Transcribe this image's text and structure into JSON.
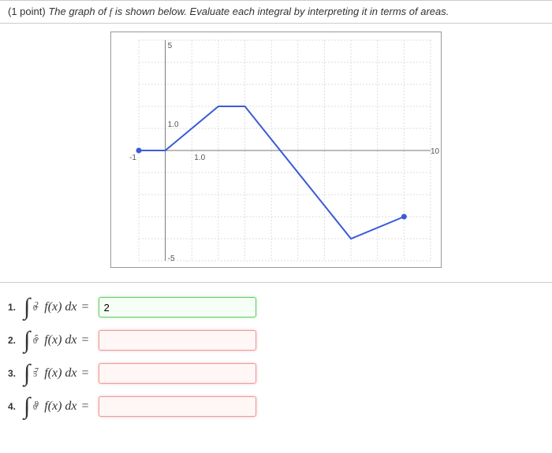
{
  "header": {
    "points": "(1 point)",
    "prompt_before": "The graph of ",
    "prompt_var": "f",
    "prompt_after": " is shown below. Evaluate each integral by interpreting it in terms of areas."
  },
  "graph": {
    "x_range": [
      -1,
      10
    ],
    "y_range": [
      -5,
      5
    ],
    "x_ticks": [
      -1,
      10
    ],
    "y_ticks": [
      -5,
      5
    ],
    "labels": {
      "y_top": "5",
      "y_mid": "1.0",
      "y_bot": "-5",
      "x_left": "-1",
      "x_mid": "1.0",
      "x_right": "10"
    },
    "points_data": [
      {
        "x": -1,
        "y": 0
      },
      {
        "x": 0,
        "y": 0
      },
      {
        "x": 2,
        "y": 2
      },
      {
        "x": 3,
        "y": 2
      },
      {
        "x": 7,
        "y": -4
      },
      {
        "x": 9,
        "y": -3
      }
    ]
  },
  "chart_data": {
    "type": "line",
    "x": [
      -1,
      0,
      2,
      3,
      7,
      9
    ],
    "y": [
      0,
      0,
      2,
      2,
      -4,
      -3
    ],
    "title": "",
    "xlabel": "",
    "ylabel": "",
    "xlim": [
      -1,
      10
    ],
    "ylim": [
      -5,
      5
    ]
  },
  "questions": [
    {
      "num": "1.",
      "lower": "0",
      "upper": "2",
      "integrand": "f(x) dx",
      "eq": "=",
      "value": "2",
      "status": "correct"
    },
    {
      "num": "2.",
      "lower": "0",
      "upper": "5",
      "integrand": "f(x) dx",
      "eq": "=",
      "value": "",
      "status": "wrong"
    },
    {
      "num": "3.",
      "lower": "5",
      "upper": "7",
      "integrand": "f(x) dx",
      "eq": "=",
      "value": "",
      "status": "wrong"
    },
    {
      "num": "4.",
      "lower": "0",
      "upper": "9",
      "integrand": "f(x) dx",
      "eq": "=",
      "value": "",
      "status": "wrong"
    }
  ]
}
